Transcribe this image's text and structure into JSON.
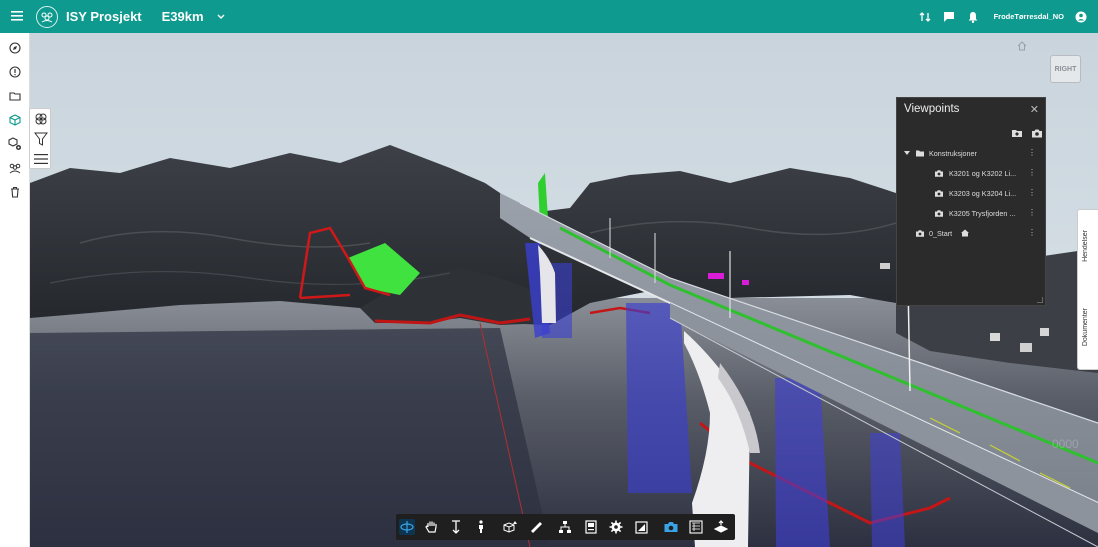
{
  "header": {
    "app_title": "ISY Prosjekt",
    "project": "E39km",
    "username": "FrodeTørresdal_NO",
    "icons": [
      "menu-icon",
      "logo-icon",
      "chevron-down-icon",
      "sort-icon",
      "chat-icon",
      "bell-icon",
      "account-icon"
    ]
  },
  "sidebar": {
    "items": [
      {
        "name": "compass-icon"
      },
      {
        "name": "info-icon"
      },
      {
        "name": "folder-icon"
      },
      {
        "name": "model-cube-icon",
        "active": true
      },
      {
        "name": "model-settings-icon"
      },
      {
        "name": "users-icon"
      },
      {
        "name": "trash-icon"
      }
    ]
  },
  "float_tools": [
    "layers-icon",
    "filter-icon",
    "list-icon"
  ],
  "viewer": {
    "nav_cube_label": "RIGHT",
    "distance_text": "0000",
    "colors": {
      "accent": "#0e9a8e",
      "active_tool": "#3aa3e8"
    }
  },
  "viewpoints": {
    "title": "Viewpoints",
    "folder": "Konstruksjoner",
    "items": [
      {
        "label": "K3201 og K3202 Li..."
      },
      {
        "label": "K3203 og K3204 Li..."
      },
      {
        "label": "K3205 Trysfjorden ..."
      }
    ],
    "root_item": "0_Start"
  },
  "side_tabs": {
    "tab1": "Hendelser",
    "tab2": "Dokumenter"
  },
  "toolbar": {
    "tools": [
      "orbit-icon",
      "pan-icon",
      "zoom-icon",
      "walk-icon",
      "section-box-icon",
      "measure-icon",
      "model-tree-icon",
      "properties-icon",
      "settings-icon",
      "fullscreen-icon",
      "viewpoint-camera-icon",
      "clip-icon",
      "explode-icon"
    ],
    "active": [
      "orbit-icon",
      "viewpoint-camera-icon"
    ]
  }
}
